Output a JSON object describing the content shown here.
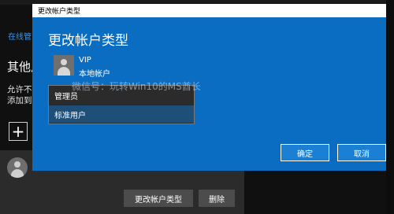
{
  "background_page": {
    "link": "在线管",
    "heading": "其他用",
    "description_line1": "允许不",
    "description_line2": "添加到",
    "add_icon": "plus-icon",
    "user_card": {
      "avatar_icon": "user-avatar-icon",
      "change_type_button": "更改帐户类型",
      "remove_button": "删除"
    }
  },
  "dialog": {
    "window_title": "更改帐户类型",
    "heading": "更改帐户类型",
    "account": {
      "name": "VIP",
      "type": "本地帐户",
      "avatar_icon": "user-avatar-icon"
    },
    "watermark": "微信号：玩转Win10的MS酋长",
    "dropdown": {
      "options": [
        "管理员",
        "标准用户"
      ],
      "selected": "标准用户"
    },
    "ok_button": "确定",
    "cancel_button": "取消"
  },
  "colors": {
    "dialog_background": "#0a6dc2",
    "page_background": "#101010",
    "selected_option": "#1e4f78",
    "link": "#3b93e8"
  }
}
